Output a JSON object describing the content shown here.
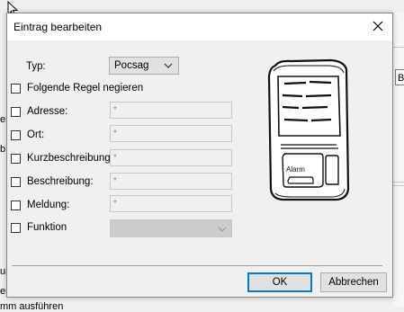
{
  "dialog": {
    "title": "Eintrag bearbeiten",
    "type_label": "Typ:",
    "type_value": "Pocsag",
    "negate_label": "Folgende Regel negieren",
    "fields": [
      {
        "label": "Adresse:",
        "value": "*"
      },
      {
        "label": "Ort:",
        "value": "*"
      },
      {
        "label": "Kurzbeschreibung:",
        "value": "*"
      },
      {
        "label": "Beschreibung:",
        "value": "*"
      },
      {
        "label": "Meldung:",
        "value": "*"
      }
    ],
    "function_label": "Funktion",
    "ok_label": "OK",
    "cancel_label": "Abbrechen",
    "pager_button_text": "Alarm"
  },
  "background": {
    "right_button": "B",
    "left_fragments": [
      "er",
      "b",
      "ur",
      "er",
      "mm ausführen"
    ]
  },
  "icons": {
    "close": "close-icon",
    "dropdown": "chevron-down-icon",
    "pager": "pager-illustration"
  }
}
